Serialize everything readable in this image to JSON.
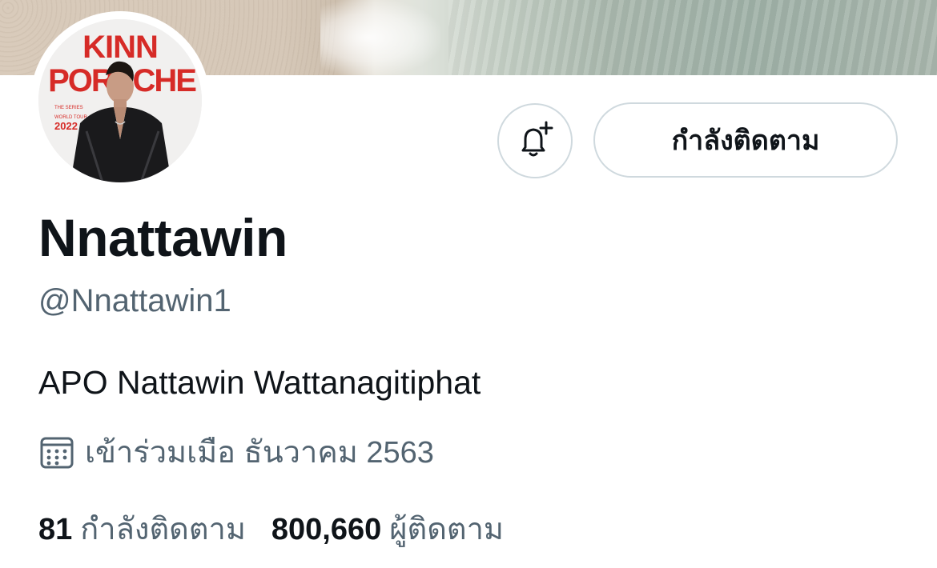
{
  "avatar": {
    "poster_title_line1": "KINN",
    "poster_title_line2": "PORSCHE",
    "poster_sub_line1": "THE SERIES",
    "poster_sub_line2": "WORLD TOUR",
    "poster_year": "2022",
    "accent_color": "#d62b27"
  },
  "actions": {
    "notify_icon": "bell-plus-icon",
    "follow_label": "กำลังติดตาม"
  },
  "profile": {
    "display_name": "Nnattawin",
    "handle": "@Nnattawin1",
    "bio": "APO Nattawin Wattanagitiphat",
    "joined_icon": "calendar-icon",
    "joined_text": "เข้าร่วมเมือ ธันวาคม 2563"
  },
  "stats": {
    "following_count": "81",
    "following_label": "กำลังติดตาม",
    "followers_count": "800,660",
    "followers_label": "ผู้ติดตาม"
  },
  "colors": {
    "text_primary": "#0f1419",
    "text_secondary": "#536471",
    "border": "#cfd9de"
  }
}
